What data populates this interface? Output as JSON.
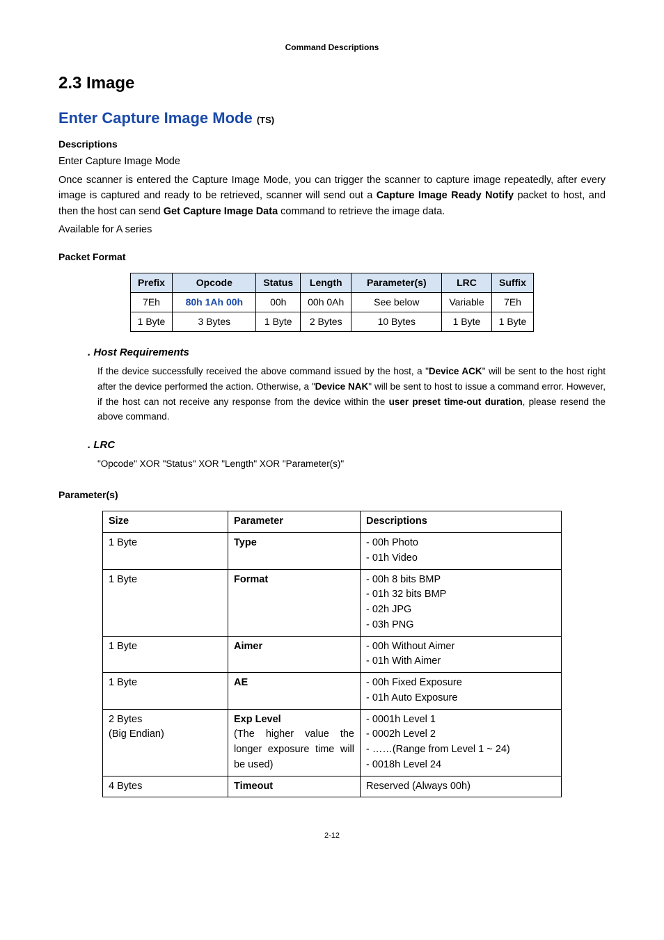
{
  "header": "Command Descriptions",
  "h1": "2.3 Image",
  "h2_main": "Enter Capture Image Mode ",
  "h2_ts": "(TS)",
  "desc_label": "Descriptions",
  "desc_line1": "Enter Capture Image Mode",
  "desc_para_a": "Once scanner is entered the Capture Image Mode, you can trigger the scanner to capture image repeatedly, after every image is captured and ready to be retrieved, scanner will send out a ",
  "desc_para_b_bold": "Capture Image Ready Notify",
  "desc_para_c": " packet to host, and then the host can send ",
  "desc_para_d_bold": "Get Capture Image Data",
  "desc_para_e": " command to retrieve the image data.",
  "desc_avail": "Available for A series",
  "pf_label": "Packet Format",
  "packet": {
    "headers": [
      "Prefix",
      "Opcode",
      "Status",
      "Length",
      "Parameter(s)",
      "LRC",
      "Suffix"
    ],
    "row1": [
      "7Eh",
      "80h 1Ah 00h",
      "00h",
      "00h 0Ah",
      "See below",
      "Variable",
      "7Eh"
    ],
    "row2": [
      "1 Byte",
      "3 Bytes",
      "1 Byte",
      "2 Bytes",
      "10 Bytes",
      "1 Byte",
      "1 Byte"
    ]
  },
  "host_head": ". Host Requirements",
  "host_a": "If the device successfully received the above command issued by the host, a \"",
  "host_b_bold": "Device ACK",
  "host_c": "\" will be sent to the host right after the device performed the action. Otherwise, a \"",
  "host_d_bold": "Device NAK",
  "host_e": "\" will be sent to host to issue a command error. However, if the host can not receive any response from the device within the ",
  "host_f_bold": "user preset time-out duration",
  "host_g": ", please resend the above command.",
  "lrc_head": ". LRC",
  "lrc_body": "\"Opcode\" XOR \"Status\" XOR \"Length\" XOR \"Parameter(s)\"",
  "params_label": "Parameter(s)",
  "params_header": {
    "size": "Size",
    "param": "Parameter",
    "desc": "Descriptions"
  },
  "params_rows": [
    {
      "size": "1 Byte",
      "param_bold": "Type",
      "param_extra": "",
      "desc": [
        "- 00h Photo",
        "- 01h Video"
      ]
    },
    {
      "size": "1 Byte",
      "param_bold": "Format",
      "param_extra": "",
      "desc": [
        "- 00h 8 bits BMP",
        "- 01h 32 bits BMP",
        "- 02h JPG",
        "- 03h PNG"
      ]
    },
    {
      "size": "1 Byte",
      "param_bold": "Aimer",
      "param_extra": "",
      "desc": [
        "- 00h Without Aimer",
        "- 01h With Aimer"
      ]
    },
    {
      "size": "1 Byte",
      "param_bold": "AE",
      "param_extra": "",
      "desc": [
        "- 00h Fixed Exposure",
        "- 01h Auto Exposure"
      ]
    },
    {
      "size": "2 Bytes\n(Big Endian)",
      "param_bold": "Exp Level",
      "param_extra": "(The higher value the longer exposure time will be used)",
      "desc": [
        "- 0001h Level 1",
        "- 0002h Level 2",
        "- ……(Range from Level 1 ~ 24)",
        "- 0018h Level 24"
      ]
    },
    {
      "size": "4 Bytes",
      "param_bold": "Timeout",
      "param_extra": "",
      "desc": [
        "Reserved (Always 00h)"
      ]
    }
  ],
  "page_number": "2-12"
}
